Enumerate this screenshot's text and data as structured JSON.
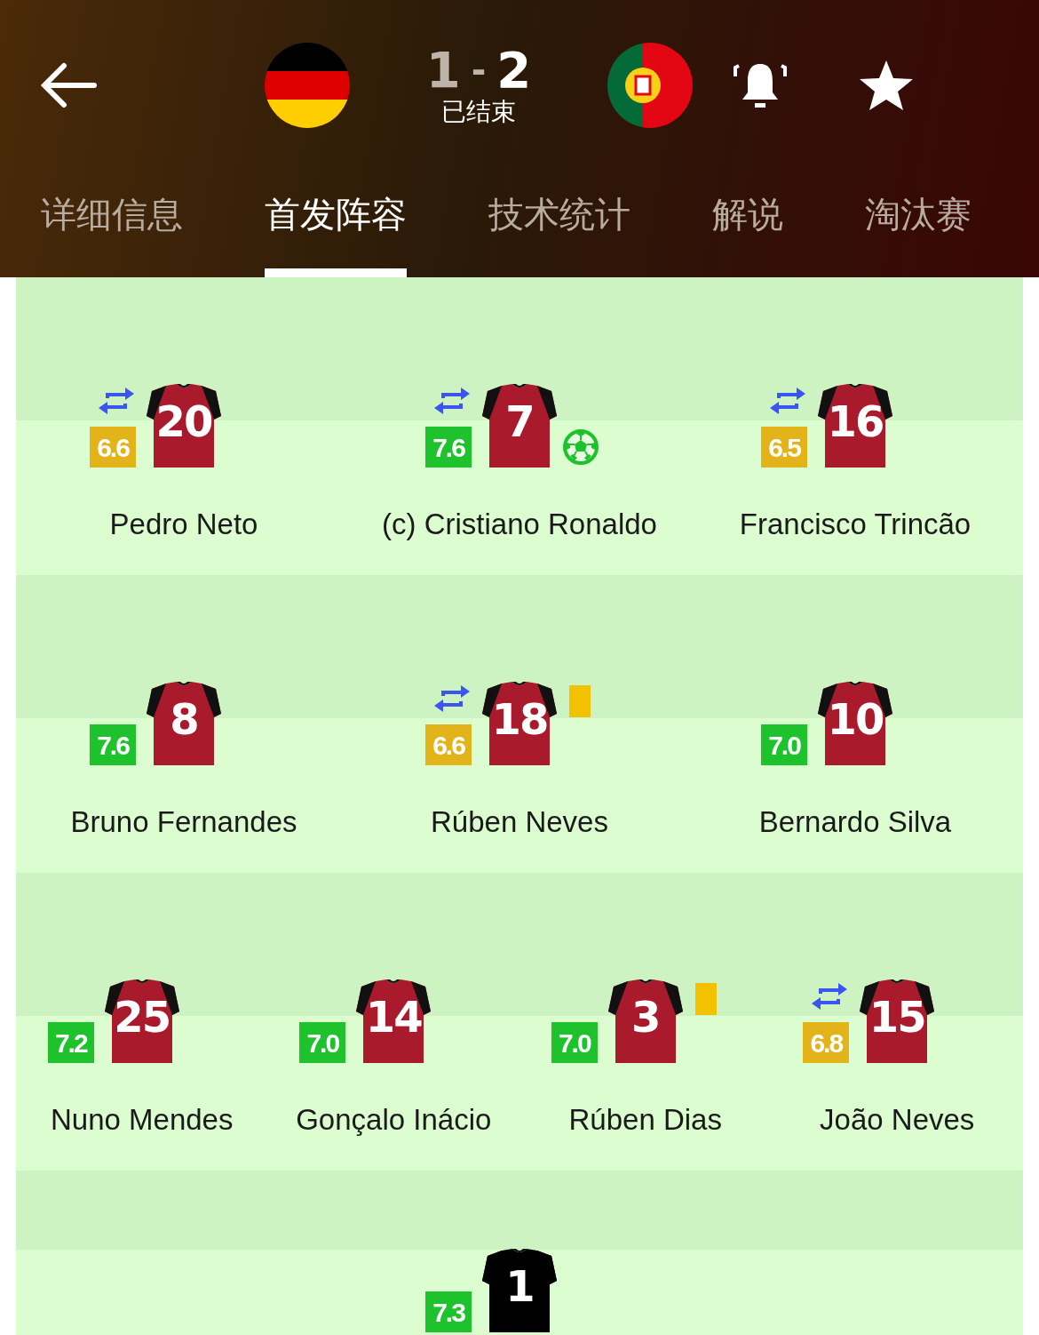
{
  "header": {
    "score": {
      "home": "1",
      "separator": "-",
      "away": "2"
    },
    "status": "已结束"
  },
  "tabs": [
    {
      "label": "详细信息",
      "selected": false
    },
    {
      "label": "首发阵容",
      "selected": true
    },
    {
      "label": "技术统计",
      "selected": false
    },
    {
      "label": "解说",
      "selected": false
    },
    {
      "label": "淘汰赛",
      "selected": false
    }
  ],
  "lines": [
    {
      "players": [
        {
          "kind": "outfield",
          "number": "20",
          "rating": "6.6",
          "color": "#e3b31a",
          "name": "Pedro Neto",
          "substituted": true,
          "yellow_card": false,
          "goal": false
        },
        {
          "kind": "outfield",
          "number": "7",
          "rating": "7.6",
          "color": "#1ec22c",
          "name": "(c) Cristiano Ronaldo",
          "substituted": true,
          "yellow_card": false,
          "goal": true
        },
        {
          "kind": "outfield",
          "number": "16",
          "rating": "6.5",
          "color": "#e3b31a",
          "name": "Francisco Trincão",
          "substituted": true,
          "yellow_card": false,
          "goal": false
        }
      ]
    },
    {
      "players": [
        {
          "kind": "outfield",
          "number": "8",
          "rating": "7.6",
          "color": "#1ec22c",
          "name": "Bruno Fernandes",
          "substituted": false,
          "yellow_card": false,
          "goal": false
        },
        {
          "kind": "outfield",
          "number": "18",
          "rating": "6.6",
          "color": "#e3b31a",
          "name": "Rúben Neves",
          "substituted": true,
          "yellow_card": true,
          "goal": false
        },
        {
          "kind": "outfield",
          "number": "10",
          "rating": "7.0",
          "color": "#1ec22c",
          "name": "Bernardo Silva",
          "substituted": false,
          "yellow_card": false,
          "goal": false
        }
      ]
    },
    {
      "players": [
        {
          "kind": "outfield",
          "number": "25",
          "rating": "7.2",
          "color": "#1ec22c",
          "name": "Nuno Mendes",
          "substituted": false,
          "yellow_card": false,
          "goal": false
        },
        {
          "kind": "outfield",
          "number": "14",
          "rating": "7.0",
          "color": "#1ec22c",
          "name": "Gonçalo Inácio",
          "substituted": false,
          "yellow_card": false,
          "goal": false
        },
        {
          "kind": "outfield",
          "number": "3",
          "rating": "7.0",
          "color": "#1ec22c",
          "name": "Rúben Dias",
          "substituted": false,
          "yellow_card": true,
          "goal": false
        },
        {
          "kind": "outfield",
          "number": "15",
          "rating": "6.8",
          "color": "#e3b31a",
          "name": "João Neves",
          "substituted": true,
          "yellow_card": false,
          "goal": false
        }
      ]
    },
    {
      "players": [
        {
          "kind": "goalkeeper",
          "number": "1",
          "rating": "7.3",
          "color": "#1ec22c",
          "substituted": false,
          "yellow_card": false,
          "goal": false
        }
      ]
    }
  ]
}
